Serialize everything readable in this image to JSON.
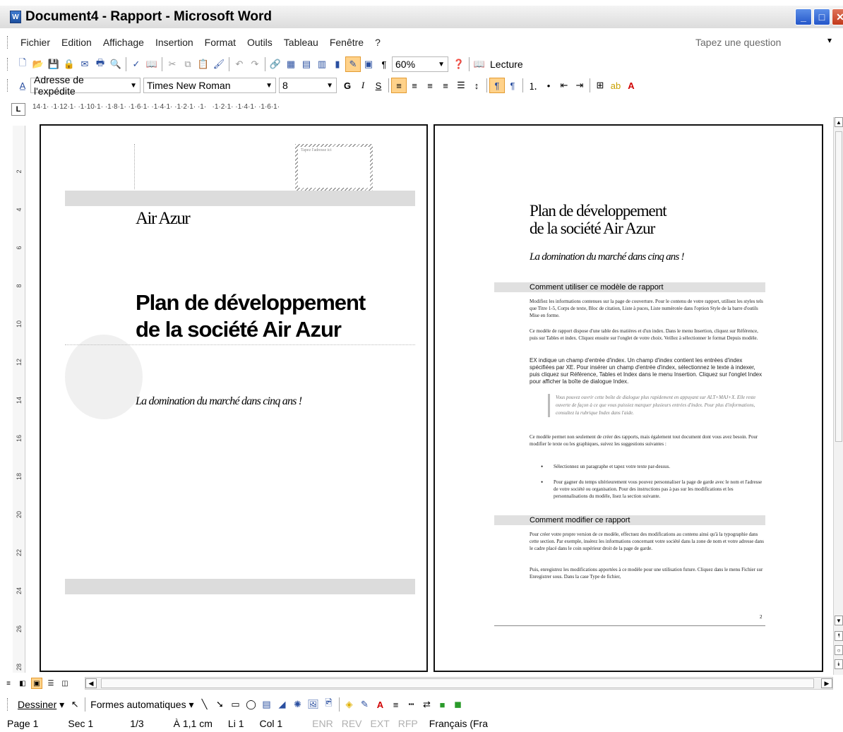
{
  "window": {
    "title": "Document4 - Rapport - Microsoft Word"
  },
  "menu": [
    "Fichier",
    "Edition",
    "Affichage",
    "Insertion",
    "Format",
    "Outils",
    "Tableau",
    "Fenêtre",
    "?"
  ],
  "help_box": {
    "placeholder": "Tapez une question"
  },
  "standard_toolbar": {
    "zoom": "60%",
    "reading_label": "Lecture"
  },
  "format_toolbar": {
    "style": "Adresse de l'expédite",
    "font": "Times New Roman",
    "size": "8",
    "bold": "G",
    "italic": "I",
    "underline": "S"
  },
  "ruler": {
    "marks": "14·1· ·1·12·1· ·1·10·1· ·1·8·1· ·1·6·1· ·1·4·1· ·1·2·1· ·1·   ·1·2·1· ·1·4·1· ·1·6·1·"
  },
  "vruler_marks": [
    "2",
    "4",
    "6",
    "8",
    "10",
    "12",
    "14",
    "16",
    "18",
    "20",
    "22",
    "24",
    "26",
    "28"
  ],
  "page1": {
    "address_hint": "Tapez l'adresse ici",
    "company": "Air Azur",
    "title_line1": "Plan de développement",
    "title_line2": "de la société Air Azur",
    "subtitle": "La domination du marché dans cinq ans !"
  },
  "page2": {
    "title_line1": "Plan de développement",
    "title_line2": "de la société Air Azur",
    "subtitle": "La domination du marché dans cinq ans !",
    "section1": "Comment utiliser ce modèle de rapport",
    "p1": "Modifiez les informations contenues sur la page de couverture. Pour le contenu de votre rapport, utilisez les styles tels que Titre 1-5, Corps de texte, Bloc de citation, Liste à puces, Liste numérotée dans l'option Style de la barre d'outils Mise en forme.",
    "p2": "Ce modèle de rapport dispose d'une table des matières et d'un index. Dans le menu Insertion, cliquez sur Référence, puis sur Tables et index. Cliquez ensuite sur l'onglet de votre choix. Veillez à sélectionner le format Depuis modèle.",
    "p3": "EX indique un champ d'entrée d'index. Un champ d'index contient les entrées d'index spécifiées par XE. Pour insérer un champ d'entrée d'index, sélectionnez le texte à indexer, puis cliquez sur Référence, Tables et Index dans le menu Insertion. Cliquez sur l'onglet Index pour afficher la boîte de dialogue Index.",
    "quote": "Vous pouvez ouvrir cette boîte de dialogue plus rapidement en appuyant sur ALT+MAJ+X. Elle reste ouverte de façon à ce que vous puissiez marquer plusieurs entrées d'index. Pour plus d'informations, consultez la rubrique Index dans l'aide.",
    "p4": "Ce modèle permet non seulement de créer des rapports, mais également tout document dont vous avez besoin. Pour modifier le texte ou les graphiques, suivez les suggestions suivantes :",
    "bullet1": "Sélectionnez un paragraphe et tapez votre texte par-dessus.",
    "bullet2": "Pour gagner du temps ultérieurement vous pouvez personnaliser la page de garde avec le nom et l'adresse de votre société ou organisation. Pour des instructions pas à pas sur les modifications et les personnalisations du modèle, lisez la section suivante.",
    "section2": "Comment modifier ce rapport",
    "p5": "Pour créer votre propre version de ce modèle, effectuez des modifications au contenu ainsi qu'à la typographie dans cette section. Par exemple, insérez les informations concernant votre société dans la zone de nom et votre adresse dans le cadre placé dans le coin supérieur droit de la page de garde.",
    "p6": "Puis, enregistrez les modifications apportées à ce modèle pour une utilisation future. Cliquez dans le menu Fichier sur Enregistrer sous. Dans la case Type de fichier,",
    "page_number": "2"
  },
  "draw_toolbar": {
    "draw_label": "Dessiner",
    "autoshapes_label": "Formes automatiques"
  },
  "status": {
    "page": "Page 1",
    "section": "Sec 1",
    "pages": "1/3",
    "position": "À 1,1 cm",
    "line": "Li 1",
    "col": "Col 1",
    "enr": "ENR",
    "rev": "REV",
    "ext": "EXT",
    "rfp": "RFP",
    "language": "Français (Fra"
  }
}
